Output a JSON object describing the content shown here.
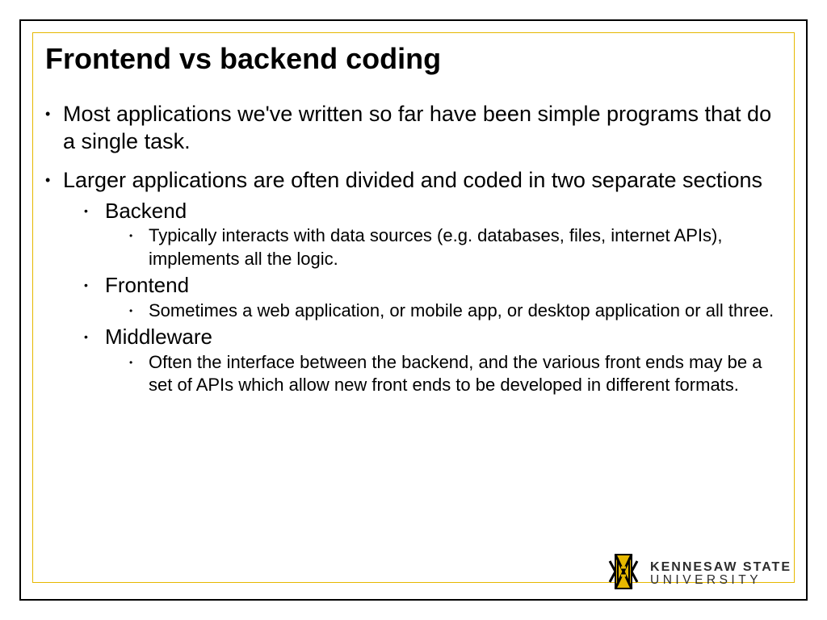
{
  "title": "Frontend vs backend coding",
  "bullets": {
    "b1": "Most applications we've written so far have been simple programs that do a single task.",
    "b2": "Larger applications are often divided and coded in two separate sections",
    "backend_label": "Backend",
    "backend_detail": "Typically interacts with data sources (e.g. databases, files, internet APIs), implements all the logic.",
    "frontend_label": "Frontend",
    "frontend_detail": "Sometimes a web application, or mobile app, or desktop application or all three.",
    "middleware_label": "Middleware",
    "middleware_detail": "Often the interface between the backend, and the various front ends may be a set of APIs which allow new front ends to be developed in different formats."
  },
  "logo": {
    "line1": "KENNESAW STATE",
    "line2": "UNIVERSITY"
  }
}
